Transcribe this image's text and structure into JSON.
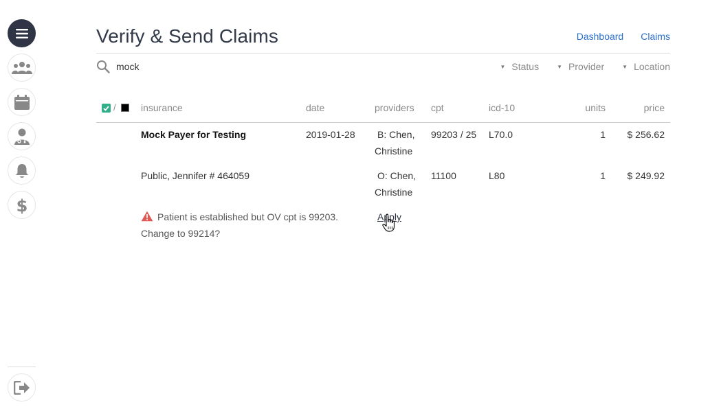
{
  "app": {
    "title": "Verify & Send Claims"
  },
  "nav_links": {
    "dashboard": "Dashboard",
    "claims": "Claims"
  },
  "sidebar": {
    "items": [
      {
        "icon": "menu-icon",
        "active": true
      },
      {
        "icon": "users-icon",
        "active": false
      },
      {
        "icon": "calendar-icon",
        "active": false
      },
      {
        "icon": "doctor-icon",
        "active": false
      },
      {
        "icon": "bell-icon",
        "active": false
      },
      {
        "icon": "dollar-icon",
        "active": false
      }
    ],
    "bottom": {
      "icon": "logout-icon"
    }
  },
  "search": {
    "value": "mock",
    "icon": "search-icon"
  },
  "filters": {
    "status": "Status",
    "provider": "Provider",
    "location": "Location"
  },
  "table": {
    "select_separator": "/",
    "columns": {
      "insurance": "insurance",
      "date": "date",
      "providers": "providers",
      "cpt": "cpt",
      "icd10": "icd-10",
      "units": "units",
      "price": "price"
    },
    "rows": [
      {
        "insurance": "Mock Payer for Testing",
        "date": "2019-01-28",
        "providers_line1": "B: Chen,",
        "providers_line2": "Christine",
        "cpt": "99203 / 25",
        "icd10": "L70.0",
        "units": "1",
        "price": "$ 256.62"
      },
      {
        "insurance": "Public, Jennifer # 464059",
        "date": "",
        "providers_line1": "O: Chen,",
        "providers_line2": "Christine",
        "cpt": "11100",
        "icd10": "L80",
        "units": "1",
        "price": "$ 249.92"
      }
    ]
  },
  "warning": {
    "icon": "warning-icon",
    "color": "#e05a55",
    "text": "Patient is established but OV cpt is 99203. Change to 99214?",
    "action": "Apply"
  },
  "colors": {
    "sidebar_active": "#2f3545",
    "link": "#2a6fc9",
    "check_green": "#2fb08a"
  }
}
